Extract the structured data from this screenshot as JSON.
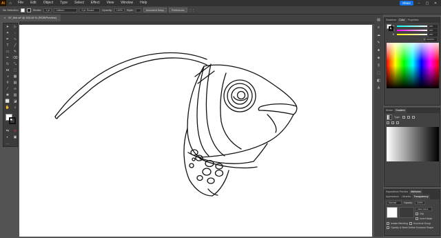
{
  "app": {
    "logo": "Ai"
  },
  "menu": [
    "File",
    "Edit",
    "Object",
    "Type",
    "Select",
    "Effect",
    "View",
    "Window",
    "Help"
  ],
  "menubar_right": {
    "share_label": "Share"
  },
  "control_bar": {
    "selection": "No Selection",
    "stroke_label": "Stroke:",
    "stroke_value": "1 pt",
    "profile": "Uniform",
    "brush": "3 pt. Round",
    "opacity_label": "Opacity:",
    "opacity_value": "100%",
    "style_label": "Style:",
    "doc_setup": "Document Setup",
    "preferences": "Preferences"
  },
  "document_tab": {
    "title": "87_fish.ai* @ 163.46 % (RGB/Preview)",
    "close": "×"
  },
  "panels": {
    "swatches_tab": "Swatches",
    "color_tab": "Color",
    "properties_tab": "Properties",
    "color_values": {
      "r": "255",
      "g": "255",
      "b": "255"
    },
    "hex": "FFFFFF",
    "stroke_tab": "Stroke",
    "gradient_tab": "Gradient",
    "gradient_type_label": "Type:",
    "separations_tab": "Separations Preview",
    "attributes_tab": "Attributes",
    "appearance_tab": "Appearance",
    "libraries_tab": "Libraries",
    "transparency_tab": "Transparency",
    "blend_mode": "Normal",
    "opacity_label": "Opacity:",
    "opacity_value": "100%",
    "isolate_blending": "Isolate Blending",
    "knockout_group": "Knockout Group",
    "opacity_mask": "Opacity & Mask Define Knockout Shape",
    "make_mask": "Make Mask",
    "clip": "Clip",
    "invert_mask": "Invert Mask"
  },
  "colors": {
    "accent": "#1473e6",
    "panel": "#424242",
    "canvas": "#535353"
  }
}
